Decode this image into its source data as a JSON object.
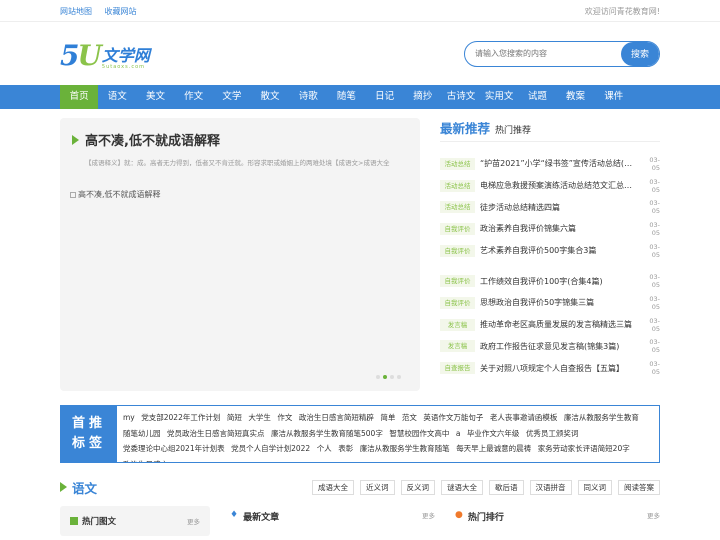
{
  "topbar": {
    "links": [
      "网站地图",
      "收藏网站"
    ],
    "welcome": "欢迎访问青花教育网!"
  },
  "logo": {
    "digits": "5",
    "letter": "U",
    "cn": "文学网",
    "en": "5utaoxs.com"
  },
  "search": {
    "placeholder": "请输入您搜索的内容",
    "button": "搜索"
  },
  "nav": [
    "首页",
    "语文",
    "美文",
    "作文",
    "文学",
    "散文",
    "诗歌",
    "随笔",
    "日记",
    "摘抄",
    "古诗文",
    "实用文",
    "试题",
    "教案",
    "课件"
  ],
  "feature": {
    "title": "高不凑,低不就成语解释",
    "desc": "【成语释义】就：成。高者无力得到，低者又不肯迁就。形容求职或婚姻上的两难处境【成语文>成语大全",
    "image_alt": "高不凑,低不就成语解释"
  },
  "latest": {
    "title": "最新推荐",
    "subtitle": "热门推荐",
    "items": [
      {
        "tag": "活动总结",
        "text": "“护苗2021”小学“绿书签”宣传活动总结(通用...",
        "date": "03-05"
      },
      {
        "tag": "活动总结",
        "text": "电梯应急救援预案演练活动总结范文汇总四篇",
        "date": "03-05"
      },
      {
        "tag": "活动总结",
        "text": "徒步活动总结精选四篇",
        "date": "03-05"
      },
      {
        "tag": "自我评价",
        "text": "政治素养自我评价锦集六篇",
        "date": "03-05"
      },
      {
        "tag": "自我评价",
        "text": "艺术素养自我评价500字集合3篇",
        "date": "03-05"
      },
      {
        "tag": "自我评价",
        "text": "工作绩效自我评价100字(合集4篇)",
        "date": "03-05"
      },
      {
        "tag": "自我评价",
        "text": "思想政治自我评价50字锦集三篇",
        "date": "03-05"
      },
      {
        "tag": "发言稿",
        "text": "推动革命老区高质量发展的发言稿精选三篇",
        "date": "03-05"
      },
      {
        "tag": "发言稿",
        "text": "政府工作报告征求意见发言稿(锦集3篇)",
        "date": "03-05"
      },
      {
        "tag": "自查报告",
        "text": "关于对照八项规定个人自查报告【五篇】",
        "date": "03-05"
      }
    ]
  },
  "tags": {
    "label_line1": "首推",
    "label_line2": "标签",
    "items": [
      "my",
      "党支部2022年工作计划",
      "简短",
      "大学生",
      "作文",
      "政治生日感言简短精辟",
      "简单",
      "范文",
      "英语作文万能句子",
      "老人丧事邀请函模板",
      "廉洁从教服务学生教育",
      "随笔幼儿园",
      "党员政治生日感言简短真实点",
      "廉洁从教服务学生教育随笔500字",
      "智慧校园作文高中",
      "a",
      "毕业作文六年级",
      "优秀员工颁奖词",
      "党委理论中心组2021年计划表",
      "党员个人自学计划2022",
      "个人",
      "表彰",
      "廉洁从教服务学生教育随笔",
      "每天早上最诚意的晨祷",
      "家务劳动家长评语简短20字",
      "政治生日感言"
    ]
  },
  "section": {
    "title": "语文",
    "chips": [
      "成语大全",
      "近义词",
      "反义词",
      "谜语大全",
      "歇后语",
      "汉语拼音",
      "同义词",
      "阅读答案"
    ]
  },
  "bottom": {
    "col1": {
      "title": "热门图文",
      "more": "更多"
    },
    "col2": {
      "icon": "bell-icon",
      "title": "最新文章",
      "more": "更多"
    },
    "col3": {
      "icon": "fire-icon",
      "title": "热门排行",
      "more": "更多"
    }
  }
}
